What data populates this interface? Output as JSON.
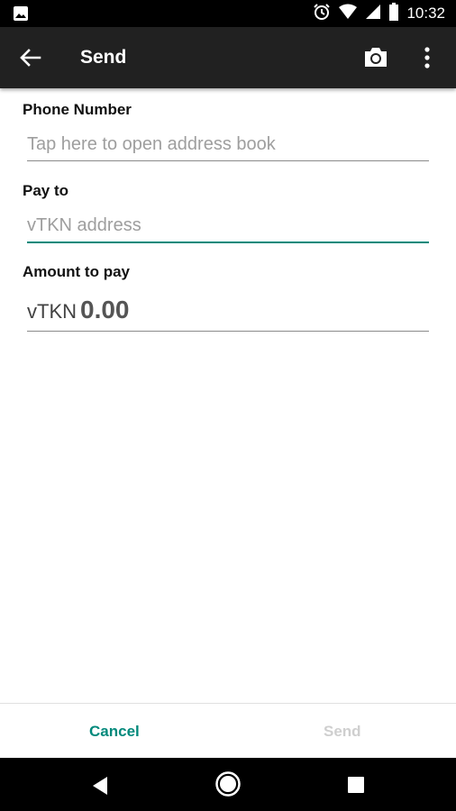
{
  "statusbar": {
    "time": "10:32",
    "icons": [
      "image-notification-icon",
      "alarm-icon",
      "wifi-icon",
      "cell-signal-icon",
      "battery-icon"
    ]
  },
  "toolbar": {
    "title": "Send",
    "back_icon": "arrow-back-icon",
    "camera_icon": "camera-icon",
    "more_icon": "more-vert-icon",
    "background": "#212121"
  },
  "form": {
    "phone": {
      "label": "Phone Number",
      "placeholder": "Tap here to open address book",
      "value": ""
    },
    "pay_to": {
      "label": "Pay to",
      "placeholder": "vTKN address",
      "value": ""
    },
    "amount": {
      "label": "Amount to pay",
      "unit": "vTKN",
      "value": "0.00"
    }
  },
  "actions": {
    "cancel_label": "Cancel",
    "send_label": "Send",
    "accent_color": "#00897b",
    "disabled_color": "#cfcfcf"
  },
  "navbar": {
    "icons": [
      "nav-back-icon",
      "nav-home-icon",
      "nav-recents-icon"
    ]
  }
}
